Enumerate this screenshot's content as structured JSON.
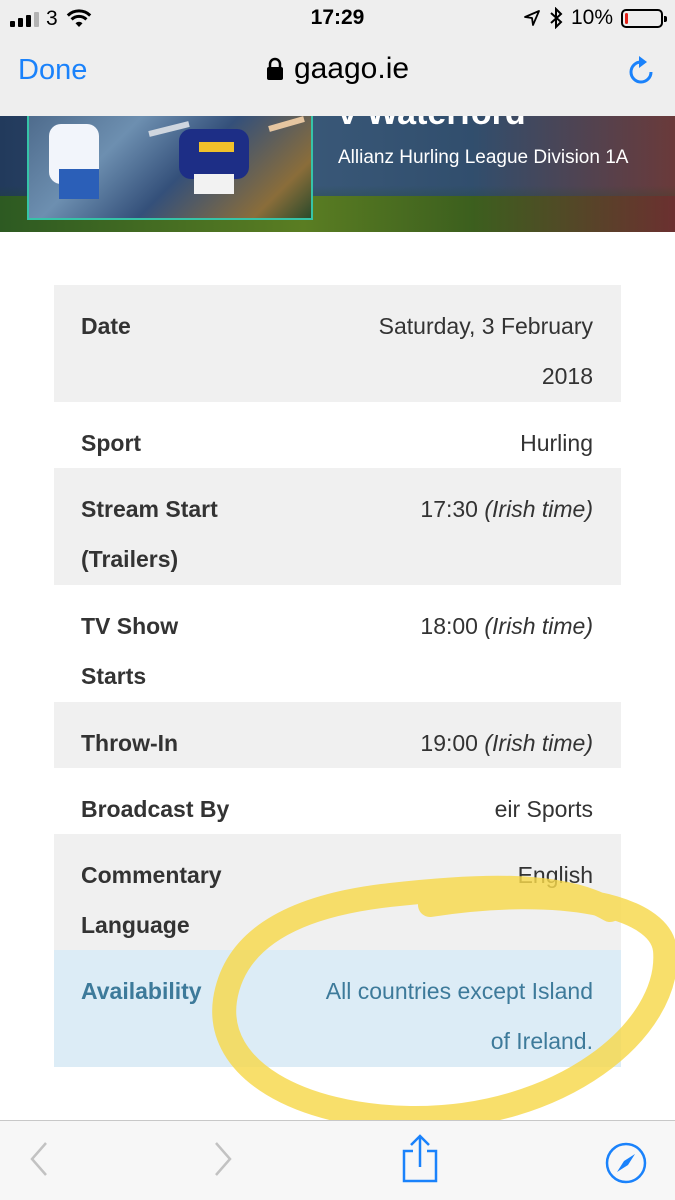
{
  "status_bar": {
    "carrier": "3",
    "time": "17:29",
    "battery_text": "10%",
    "battery_level": 0.1
  },
  "browser": {
    "done_label": "Done",
    "url": "gaago.ie"
  },
  "hero": {
    "title_partial": "v Waterford",
    "subtitle": "Allianz Hurling League Division 1A"
  },
  "details": {
    "date_label": "Date",
    "date_value": "Saturday, 3 February 2018",
    "sport_label": "Sport",
    "sport_value": "Hurling",
    "stream_label": "Stream Start (Trailers)",
    "stream_time": "17:30",
    "stream_tz": "(Irish time)",
    "tv_label": "TV Show Starts",
    "tv_time": "18:00",
    "tv_tz": "(Irish time)",
    "throwin_label": "Throw-In",
    "throwin_time": "19:00",
    "throwin_tz": "(Irish time)",
    "broadcast_label": "Broadcast By",
    "broadcast_value": "eir Sports",
    "commentary_label": "Commentary Language",
    "commentary_value": "English",
    "availability_label": "Availability",
    "availability_value": "All countries except Island of Ireland."
  },
  "colors": {
    "link_blue": "#1a82fb",
    "availability_text": "#3d7a9a",
    "availability_bg": "#dcecf6",
    "highlight_marker": "#f6d84a"
  },
  "icons": {
    "lock": "lock-icon",
    "reload": "reload-icon",
    "back": "back-arrow-icon",
    "forward": "forward-arrow-icon",
    "share": "share-icon",
    "compass": "safari-compass-icon"
  }
}
